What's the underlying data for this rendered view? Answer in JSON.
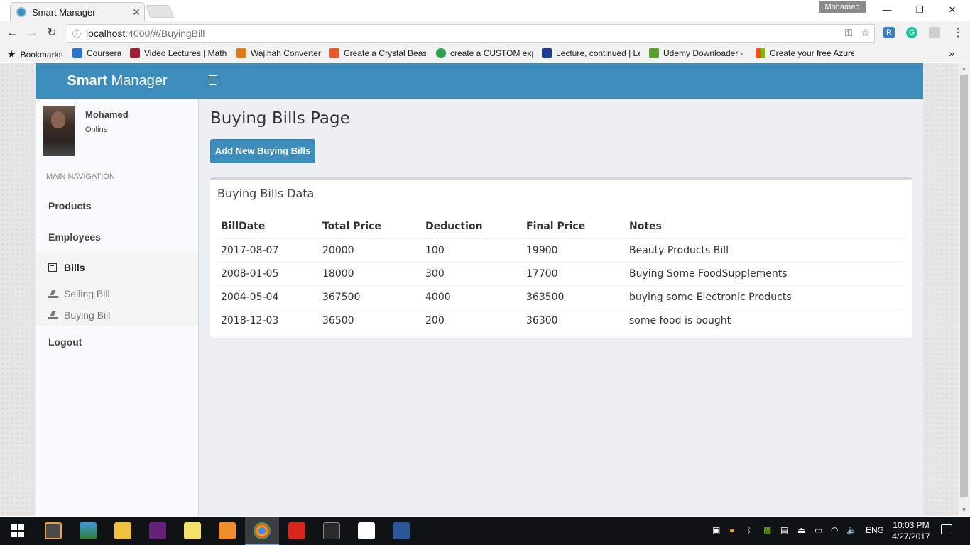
{
  "browser": {
    "tab_title": "Smart Manager",
    "tab_close": "✕",
    "profile_name": "Mohamed",
    "url_host": "localhost",
    "url_path": ":4000/#/BuyingBill",
    "bookmarks": [
      {
        "label": "Bookmarks",
        "color": "#555555"
      },
      {
        "label": "Coursera",
        "color": "#2a73cc"
      },
      {
        "label": "Video Lectures | Math",
        "color": "#a31f34"
      },
      {
        "label": "Wajihah Converter",
        "color": "#e07b1a"
      },
      {
        "label": "Create a Crystal Beast",
        "color": "#e8562a"
      },
      {
        "label": "create a CUSTOM exp",
        "color": "#2aa14a"
      },
      {
        "label": "Lecture, continued | Le",
        "color": "#1f3a93"
      },
      {
        "label": "Udemy Downloader -",
        "color": "#5a9e2f"
      },
      {
        "label": "Create your free Azure",
        "color": "#f25022"
      }
    ]
  },
  "app": {
    "logo_bold": "Smart",
    "logo_rest": " Manager",
    "brand_color": "#3c8dbc",
    "user": {
      "name": "Mohamed",
      "status": "Online"
    },
    "nav_header": "MAIN NAVIGATION",
    "nav": {
      "products": "Products",
      "employees": "Employees",
      "bills": "Bills",
      "selling_bill": "Selling Bill",
      "buying_bill": "Buying Bill",
      "logout": "Logout"
    },
    "page_title": "Buying Bills Page",
    "add_button": "Add New Buying Bills",
    "box_title": "Buying Bills Data",
    "table": {
      "headers": [
        "BillDate",
        "Total Price",
        "Deduction",
        "Final Price",
        "Notes"
      ],
      "rows": [
        [
          "2017-08-07",
          "20000",
          "100",
          "19900",
          "Beauty Products Bill"
        ],
        [
          "2008-01-05",
          "18000",
          "300",
          "17700",
          "Buying Some FoodSupplements"
        ],
        [
          "2004-05-04",
          "367500",
          "4000",
          "363500",
          "buying some Electronic Products"
        ],
        [
          "2018-12-03",
          "36500",
          "200",
          "36300",
          "some food is bought"
        ]
      ]
    }
  },
  "taskbar": {
    "language": "ENG",
    "time": "10:03 PM",
    "date": "4/27/2017"
  }
}
